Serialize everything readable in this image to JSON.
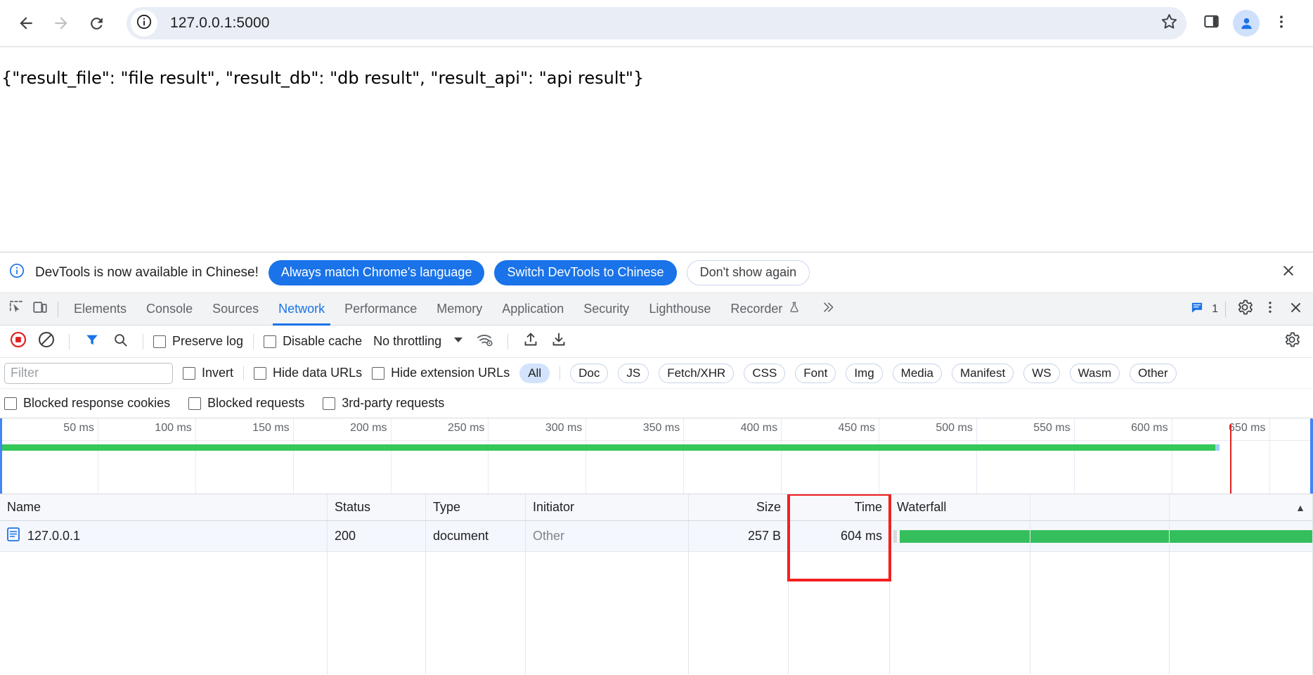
{
  "browser": {
    "back_icon": "back-arrow-icon",
    "forward_icon": "forward-arrow-icon",
    "reload_icon": "reload-icon",
    "site_info_icon": "site-info-icon",
    "url": "127.0.0.1:5000",
    "star_icon": "bookmark-star-icon",
    "side_panel_icon": "side-panel-icon",
    "avatar_icon": "profile-avatar-icon",
    "menu_icon": "three-dot-menu-icon"
  },
  "page": {
    "body_text": "{\"result_file\": \"file result\", \"result_db\": \"db result\", \"result_api\": \"api result\"}"
  },
  "devtools": {
    "banner": {
      "info_icon": "info-icon",
      "message": "DevTools is now available in Chinese!",
      "primary_btn": "Always match Chrome's language",
      "secondary_btn": "Switch DevTools to Chinese",
      "dismiss_btn": "Don't show again",
      "close_icon": "close-icon"
    },
    "tabs": [
      "Elements",
      "Console",
      "Sources",
      "Network",
      "Performance",
      "Memory",
      "Application",
      "Security",
      "Lighthouse",
      "Recorder"
    ],
    "active_tab": "Network",
    "more_tabs_icon": "chevron-double-right-icon",
    "inspect_icon": "inspect-element-icon",
    "device_toolbar_icon": "device-toolbar-icon",
    "recorder_flask_icon": "flask-icon",
    "message_icon": "message-icon",
    "message_count": "1",
    "settings_icon": "gear-icon",
    "dots_icon": "three-dot-menu-icon",
    "close_icon": "close-icon",
    "network_toolbar": {
      "record_icon": "record-stop-icon",
      "clear_icon": "clear-icon",
      "filter_icon": "filter-funnel-icon",
      "search_icon": "search-icon",
      "preserve_log": "Preserve log",
      "disable_cache": "Disable cache",
      "throttling": "No throttling",
      "throttle_caret": "caret-down-icon",
      "network_conditions_icon": "wifi-settings-icon",
      "import_har_icon": "upload-icon",
      "export_har_icon": "download-icon",
      "settings_icon": "gear-icon"
    },
    "filter_row": {
      "filter_placeholder": "Filter",
      "filter_value": "",
      "invert": "Invert",
      "hide_data_urls": "Hide data URLs",
      "hide_extension_urls": "Hide extension URLs",
      "chips": [
        "All",
        "Doc",
        "JS",
        "Fetch/XHR",
        "CSS",
        "Font",
        "Img",
        "Media",
        "Manifest",
        "WS",
        "Wasm",
        "Other"
      ],
      "selected_chip": "All"
    },
    "blocked_row": {
      "blocked_response_cookies": "Blocked response cookies",
      "blocked_requests": "Blocked requests",
      "third_party_requests": "3rd-party requests"
    },
    "overview": {
      "ticks": [
        "50 ms",
        "100 ms",
        "150 ms",
        "200 ms",
        "250 ms",
        "300 ms",
        "350 ms",
        "400 ms",
        "450 ms",
        "500 ms",
        "550 ms",
        "600 ms",
        "650 ms"
      ]
    },
    "table": {
      "columns": [
        "Name",
        "Status",
        "Type",
        "Initiator",
        "Size",
        "Time",
        "Waterfall"
      ],
      "sort_indicator": "▲",
      "rows": [
        {
          "icon": "document-file-icon",
          "name": "127.0.0.1",
          "status": "200",
          "type": "document",
          "initiator": "Other",
          "size": "257 B",
          "time": "604 ms"
        }
      ]
    }
  },
  "colors": {
    "accent": "#1a73e8",
    "waterfall_green": "#35bf5c",
    "annotation_red": "#f42020",
    "load_event_red": "#e02020"
  }
}
